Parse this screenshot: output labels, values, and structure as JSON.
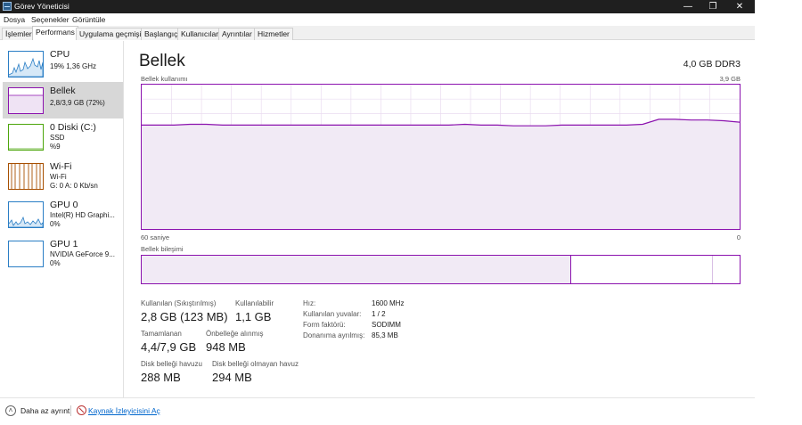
{
  "window": {
    "title": "Görev Yöneticisi",
    "minimize_glyph": "—",
    "maximize_glyph": "❐",
    "close_glyph": "✕"
  },
  "menu": [
    "Dosya",
    "Seçenekler",
    "Görüntüle"
  ],
  "tabs": [
    "İşlemler",
    "Performans",
    "Uygulama geçmişi",
    "Başlangıç",
    "Kullanıcılar",
    "Ayrıntılar",
    "Hizmetler"
  ],
  "active_tab": "Performans",
  "sidebar": {
    "items": [
      {
        "title": "CPU",
        "lines": [
          "19%  1,36 GHz"
        ],
        "color": "#2a7ec5",
        "icon": "cpu-graph-icon"
      },
      {
        "title": "Bellek",
        "lines": [
          "2,8/3,9 GB (72%)"
        ],
        "color": "#8b12ae",
        "icon": "memory-graph-icon"
      },
      {
        "title": "0 Diski (C:)",
        "lines": [
          "SSD",
          "%9"
        ],
        "color": "#4da60c",
        "icon": "disk-graph-icon"
      },
      {
        "title": "Wi-Fi",
        "lines": [
          "Wi-Fi",
          "G: 0  A: 0 Kb/sn"
        ],
        "color": "#a74f01",
        "icon": "wifi-graph-icon"
      },
      {
        "title": "GPU 0",
        "lines": [
          "Intel(R) HD Graphi...",
          "0%"
        ],
        "color": "#2a7ec5",
        "icon": "gpu0-graph-icon"
      },
      {
        "title": "GPU 1",
        "lines": [
          "NVIDIA GeForce 9...",
          "0%"
        ],
        "color": "#2a7ec5",
        "icon": "gpu1-graph-icon"
      }
    ]
  },
  "main": {
    "title": "Bellek",
    "memory_type": "4,0 GB DDR3",
    "usage_label": "Bellek kullanımı",
    "usage_max": "3,9 GB",
    "time_left": "60 saniye",
    "time_right": "0",
    "composition_label": "Bellek bileşimi",
    "accent_color": "#8b12ae",
    "usage_series": [
      0.72,
      0.72,
      0.72,
      0.725,
      0.725,
      0.72,
      0.72,
      0.72,
      0.72,
      0.72,
      0.72,
      0.72,
      0.72,
      0.72,
      0.72,
      0.72,
      0.72,
      0.72,
      0.72,
      0.72,
      0.725,
      0.72,
      0.72,
      0.715,
      0.715,
      0.715,
      0.72,
      0.72,
      0.72,
      0.72,
      0.72,
      0.725,
      0.76,
      0.76,
      0.755,
      0.755,
      0.75,
      0.74
    ],
    "composition": {
      "in_use_fraction": 0.718,
      "standby_fraction": 0.237,
      "free_fraction": 0.045
    },
    "stats": {
      "in_use_label": "Kullanılan (Sıkıştırılmış)",
      "in_use_value": "2,8 GB (123 MB)",
      "available_label": "Kullanılabilir",
      "available_value": "1,1 GB",
      "committed_label": "Tamamlanan",
      "committed_value": "4,4/7,9 GB",
      "cached_label": "Önbelleğe alınmış",
      "cached_value": "948 MB",
      "paged_label": "Disk belleği havuzu",
      "paged_value": "288 MB",
      "nonpaged_label": "Disk belleği olmayan havuz",
      "nonpaged_value": "294 MB"
    },
    "specs": [
      {
        "label": "Hız:",
        "value": "1600 MHz"
      },
      {
        "label": "Kullanılan yuvalar:",
        "value": "1 / 2"
      },
      {
        "label": "Form faktörü:",
        "value": "SODIMM"
      },
      {
        "label": "Donanıma ayrılmış:",
        "value": "85,3 MB"
      }
    ]
  },
  "footer": {
    "fewer_details": "Daha az ayrıntı",
    "open_resmon": "Kaynak İzleyicisini Aç"
  }
}
